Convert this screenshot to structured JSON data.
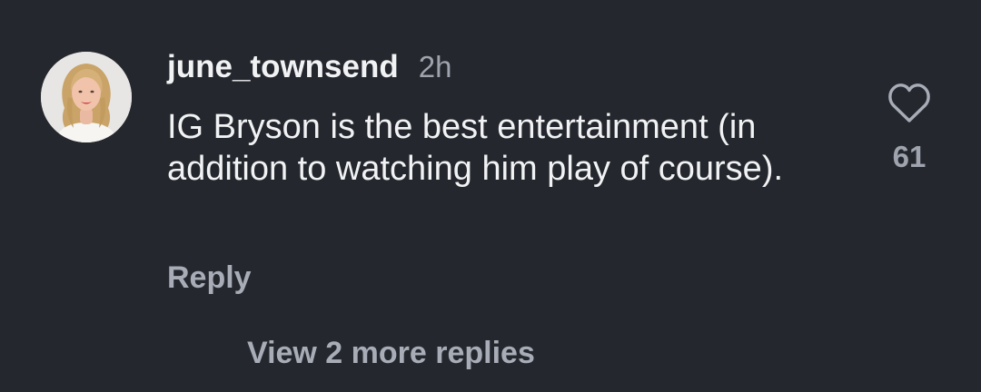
{
  "comment": {
    "username": "june_townsend",
    "timestamp": "2h",
    "text": "IG Bryson is the best entertainment (in addition to watching him play of course).",
    "reply_label": "Reply",
    "like_icon": "heart-outline-icon",
    "like_count": "61",
    "view_more_replies_label": "View 2 more replies"
  },
  "colors": {
    "background": "#24272d",
    "primary_text": "#f1f2f4",
    "secondary_text": "#9ea3ad"
  }
}
